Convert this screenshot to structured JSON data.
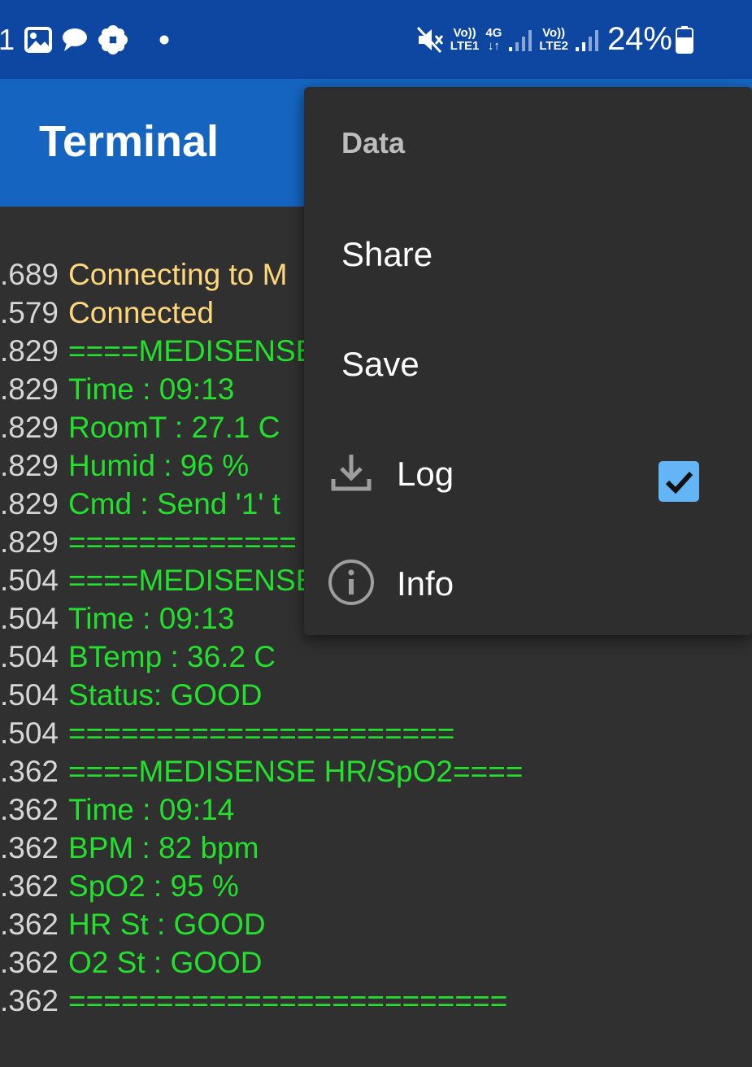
{
  "status_bar": {
    "left_number": "1",
    "signal1_top": "Vo))",
    "signal1_bottom": "LTE1",
    "net_type": "4G",
    "signal2_top": "Vo))",
    "signal2_bottom": "LTE2",
    "battery_percent": "24%",
    "icons": [
      "gallery-icon",
      "chat-icon",
      "flower-icon",
      "dot-icon",
      "mute-icon",
      "data-arrows-icon",
      "signal-icon",
      "battery-icon"
    ]
  },
  "app_bar": {
    "title": "Terminal"
  },
  "colors": {
    "status_bar": "#0d47a1",
    "app_bar": "#1565c0",
    "background": "#303030",
    "status_text": "#ffd77a",
    "data_text": "#22e02c",
    "timestamp": "#d6d6d6",
    "checkbox": "#64b5f6"
  },
  "terminal": {
    "lines": [
      {
        "ts": ".689",
        "text": "Connecting to M",
        "kind": "status"
      },
      {
        "ts": ".579",
        "text": "Connected",
        "kind": "status"
      },
      {
        "ts": ".829",
        "text": "====MEDISENSE",
        "kind": "data"
      },
      {
        "ts": ".829",
        "text": "Time  : 09:13",
        "kind": "data"
      },
      {
        "ts": ".829",
        "text": "RoomT : 27.1 C",
        "kind": "data"
      },
      {
        "ts": ".829",
        "text": "Humid : 96 %",
        "kind": "data"
      },
      {
        "ts": ".829",
        "text": "Cmd   : Send '1' t",
        "kind": "data"
      },
      {
        "ts": ".829",
        "text": "=============",
        "kind": "data"
      },
      {
        "ts": ".504",
        "text": "====MEDISENSE",
        "kind": "data"
      },
      {
        "ts": ".504",
        "text": "Time  : 09:13",
        "kind": "data"
      },
      {
        "ts": ".504",
        "text": "BTemp : 36.2 C",
        "kind": "data"
      },
      {
        "ts": ".504",
        "text": "Status: GOOD",
        "kind": "data"
      },
      {
        "ts": ".504",
        "text": "======================",
        "kind": "data"
      },
      {
        "ts": ".362",
        "text": "====MEDISENSE HR/SpO2====",
        "kind": "data"
      },
      {
        "ts": ".362",
        "text": "Time  : 09:14",
        "kind": "data"
      },
      {
        "ts": ".362",
        "text": "BPM   : 82 bpm",
        "kind": "data"
      },
      {
        "ts": ".362",
        "text": "SpO2  : 95 %",
        "kind": "data"
      },
      {
        "ts": ".362",
        "text": "HR St : GOOD",
        "kind": "data"
      },
      {
        "ts": ".362",
        "text": "O2 St : GOOD",
        "kind": "data"
      },
      {
        "ts": ".362",
        "text": "=========================",
        "kind": "data"
      }
    ]
  },
  "menu": {
    "header": "Data",
    "items": [
      {
        "label": "Share"
      },
      {
        "label": "Save"
      },
      {
        "label": "Log",
        "icon": "download-icon",
        "checked": true
      },
      {
        "label": "Info",
        "icon": "info-icon"
      }
    ]
  }
}
